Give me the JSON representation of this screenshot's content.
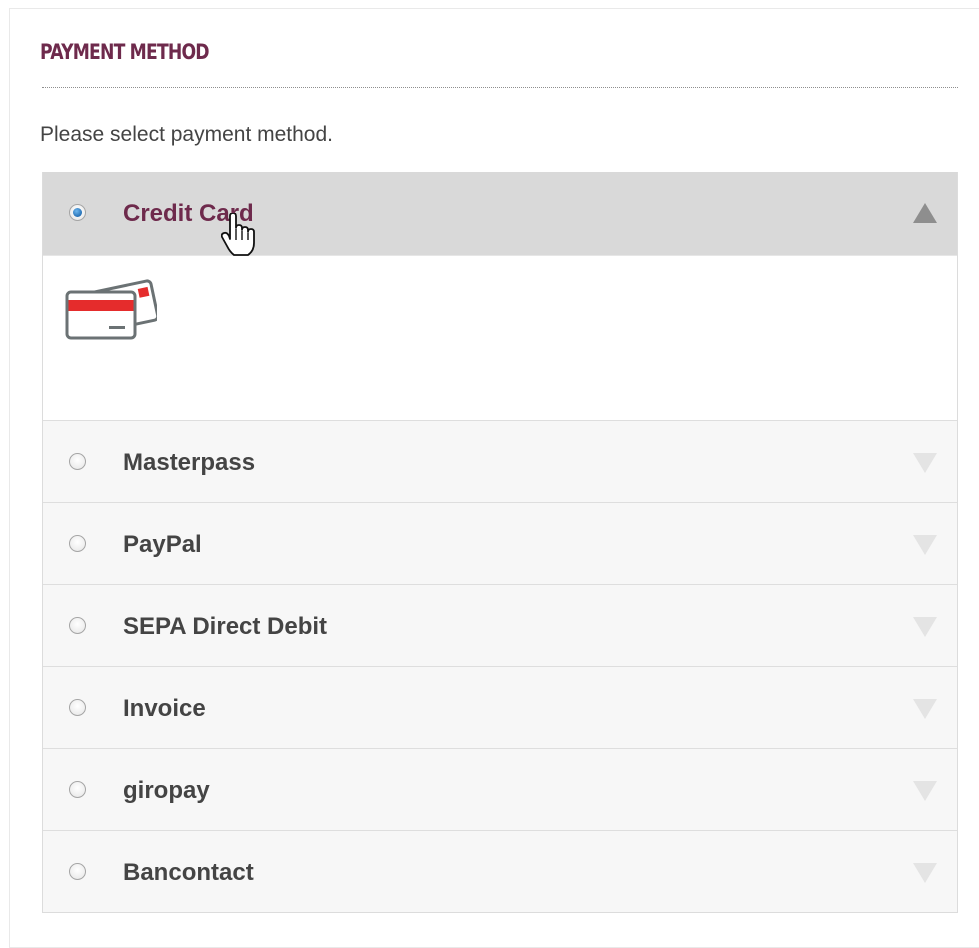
{
  "section": {
    "title": "PAYMENT METHOD",
    "intro": "Please select payment method."
  },
  "methods": [
    {
      "label": "Credit Card",
      "selected": true,
      "expanded": true
    },
    {
      "label": "Masterpass",
      "selected": false,
      "expanded": false
    },
    {
      "label": "PayPal",
      "selected": false,
      "expanded": false
    },
    {
      "label": "SEPA Direct Debit",
      "selected": false,
      "expanded": false
    },
    {
      "label": "Invoice",
      "selected": false,
      "expanded": false
    },
    {
      "label": "giropay",
      "selected": false,
      "expanded": false
    },
    {
      "label": "Bancontact",
      "selected": false,
      "expanded": false
    }
  ],
  "icons": {
    "credit_card": "credit-card-icon",
    "expand": "chevron-down-icon",
    "collapse": "chevron-up-icon",
    "cursor": "hand-pointer-icon"
  },
  "colors": {
    "accent": "#6e2a4c",
    "active_row": "#d9d9d9",
    "row": "#f7f7f7",
    "card_stripe": "#e52c2c"
  }
}
